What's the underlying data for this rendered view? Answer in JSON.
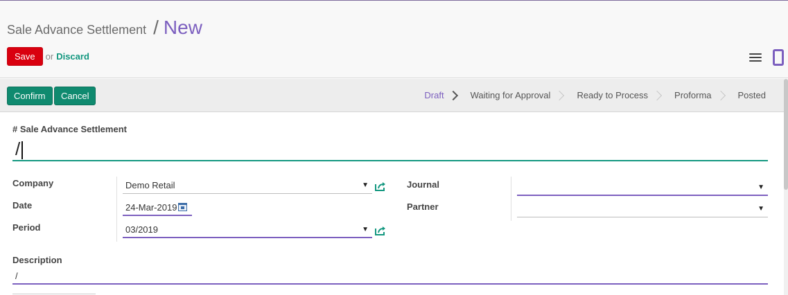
{
  "breadcrumb": {
    "parent": "Sale Advance Settlement",
    "separator": "/",
    "current": "New"
  },
  "actions": {
    "save_label": "Save",
    "or_text": "or",
    "discard_label": "Discard"
  },
  "toolbar_icons": [
    "hamburger-icon",
    "mobile-icon"
  ],
  "statusbar": {
    "confirm_label": "Confirm",
    "cancel_label": "Cancel",
    "stages": [
      "Draft",
      "Waiting for Approval",
      "Ready to Process",
      "Proforma",
      "Posted"
    ],
    "active_stage": "Draft"
  },
  "form": {
    "name_label": "# Sale Advance Settlement",
    "name_value": "/",
    "company_label": "Company",
    "company_value": "Demo Retail",
    "date_label": "Date",
    "date_value": "24-Mar-2019",
    "period_label": "Period",
    "period_value": "03/2019",
    "journal_label": "Journal",
    "journal_value": "",
    "partner_label": "Partner",
    "partner_value": "",
    "description_label": "Description",
    "description_value": "/"
  },
  "colors": {
    "primary_purple": "#7c5fbf",
    "save_red": "#d9000f",
    "action_teal": "#0f8a6f",
    "link_teal": "#12977f"
  }
}
